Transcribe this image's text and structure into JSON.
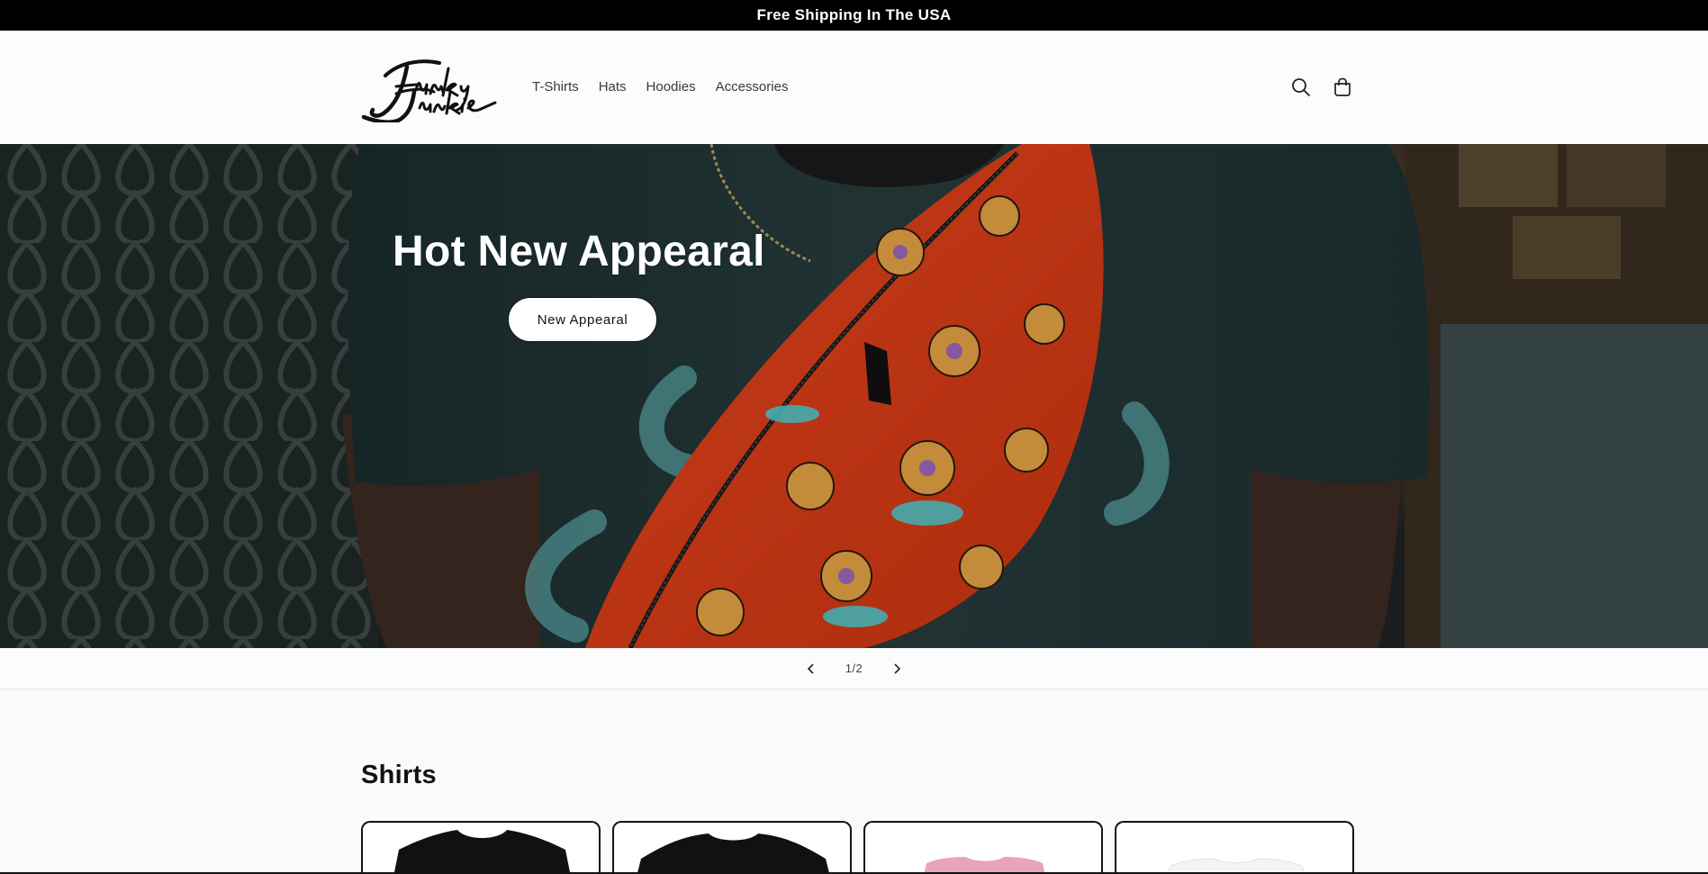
{
  "announcement": {
    "text": "Free Shipping In The USA"
  },
  "header": {
    "logo_text": "Funky Junkie",
    "nav": [
      {
        "label": "T-Shirts"
      },
      {
        "label": "Hats"
      },
      {
        "label": "Hoodies"
      },
      {
        "label": "Accessories"
      }
    ],
    "icons": {
      "search": "search-icon",
      "cart": "cart-icon"
    }
  },
  "hero": {
    "title": "Hot New Appearal",
    "button_label": "New Appearal"
  },
  "slider": {
    "counter": "1/2"
  },
  "collection": {
    "title": "Shirts",
    "products": [
      {
        "shirt_color": "#111111"
      },
      {
        "shirt_color": "#111111"
      },
      {
        "shirt_color": "#e8a3be"
      },
      {
        "shirt_color": "#f4f4f4"
      }
    ]
  },
  "colors": {
    "announcement_bg": "#000000",
    "text": "#121212",
    "background": "#fafafa"
  }
}
